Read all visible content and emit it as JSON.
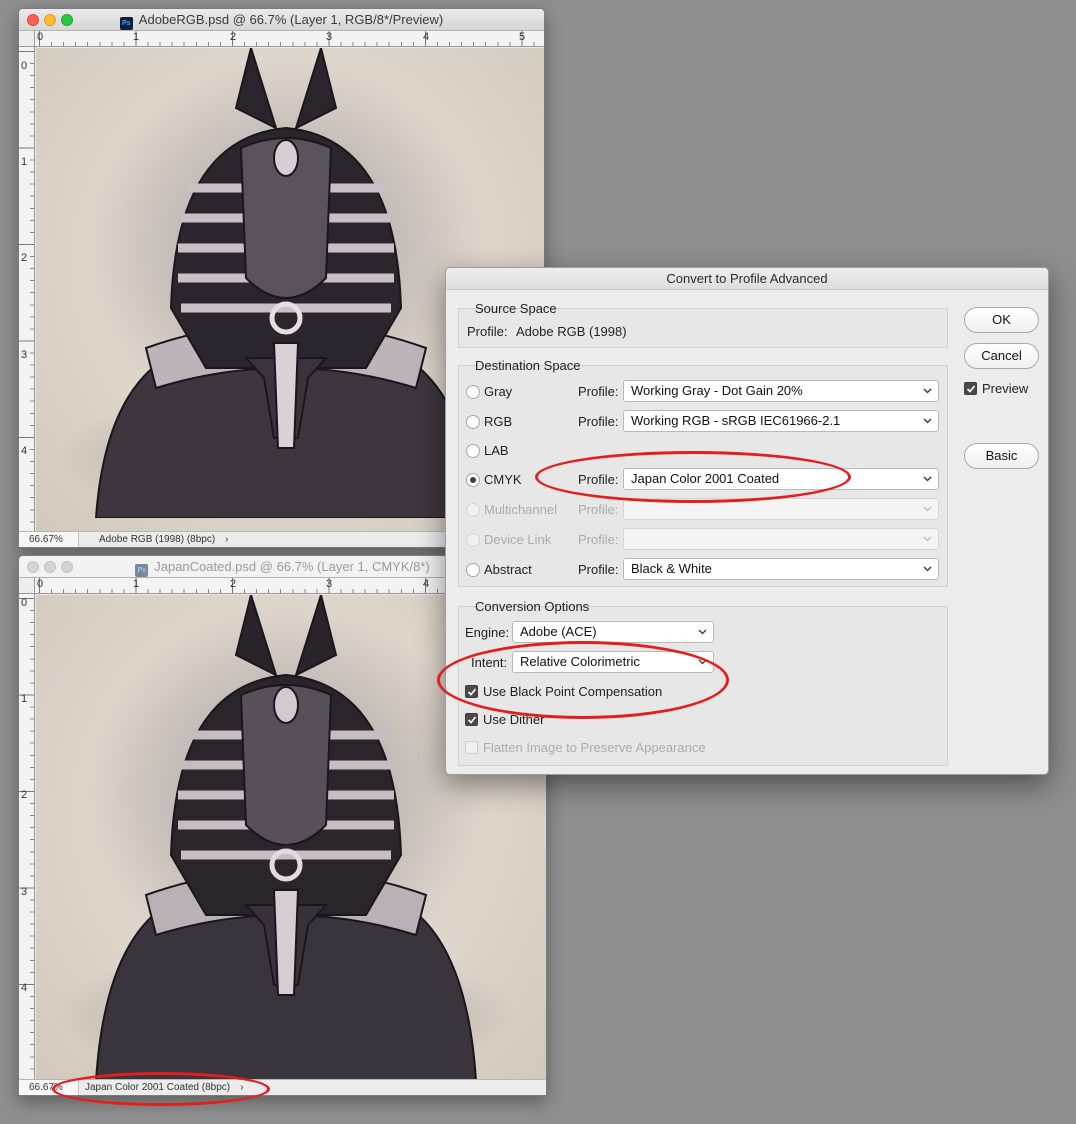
{
  "window_top": {
    "title": "AdobeRGB.psd @ 66.7% (Layer 1, RGB/8*/Preview)",
    "app_icon": "Ps",
    "zoom": "66.67%",
    "profile_info": "Adobe RGB (1998) (8bpc)",
    "ruler_h": [
      "0",
      "1",
      "2",
      "3",
      "4",
      "5"
    ],
    "ruler_v": [
      "0",
      "1",
      "2",
      "3",
      "4"
    ]
  },
  "window_bottom": {
    "title": "JapanCoated.psd @ 66.7% (Layer 1, CMYK/8*)",
    "app_icon": "Ps",
    "zoom": "66.67%",
    "profile_info": "Japan Color 2001 Coated (8bpc)",
    "ruler_h": [
      "0",
      "1",
      "2",
      "3",
      "4"
    ],
    "ruler_v": [
      "0",
      "1",
      "2",
      "3",
      "4"
    ]
  },
  "status_chevron": "›",
  "dialog": {
    "title": "Convert to Profile Advanced",
    "source_space": {
      "title": "Source Space",
      "profile_label": "Profile:",
      "profile_value": "Adobe RGB (1998)"
    },
    "destination_space": {
      "title": "Destination Space",
      "profile_label": "Profile:",
      "options": [
        {
          "label": "Gray",
          "profile": "Working Gray - Dot Gain 20%",
          "selected": false,
          "enabled": true
        },
        {
          "label": "RGB",
          "profile": "Working RGB - sRGB IEC61966-2.1",
          "selected": false,
          "enabled": true
        },
        {
          "label": "LAB",
          "profile": "",
          "selected": false,
          "enabled": true
        },
        {
          "label": "CMYK",
          "profile": "Japan Color 2001 Coated",
          "selected": true,
          "enabled": true
        },
        {
          "label": "Multichannel",
          "profile": "",
          "selected": false,
          "enabled": false
        },
        {
          "label": "Device Link",
          "profile": "",
          "selected": false,
          "enabled": false
        },
        {
          "label": "Abstract",
          "profile": "Black & White",
          "selected": false,
          "enabled": true
        }
      ]
    },
    "conversion_options": {
      "title": "Conversion Options",
      "engine_label": "Engine:",
      "engine_value": "Adobe (ACE)",
      "intent_label": "Intent:",
      "intent_value": "Relative Colorimetric",
      "black_point": "Use Black Point Compensation",
      "dither": "Use Dither",
      "flatten": "Flatten Image to Preserve Appearance"
    },
    "buttons": {
      "ok": "OK",
      "cancel": "Cancel",
      "preview": "Preview",
      "basic": "Basic"
    }
  },
  "colors": {
    "annotation": "#e41d1d",
    "canvas": "#ded6cb"
  }
}
